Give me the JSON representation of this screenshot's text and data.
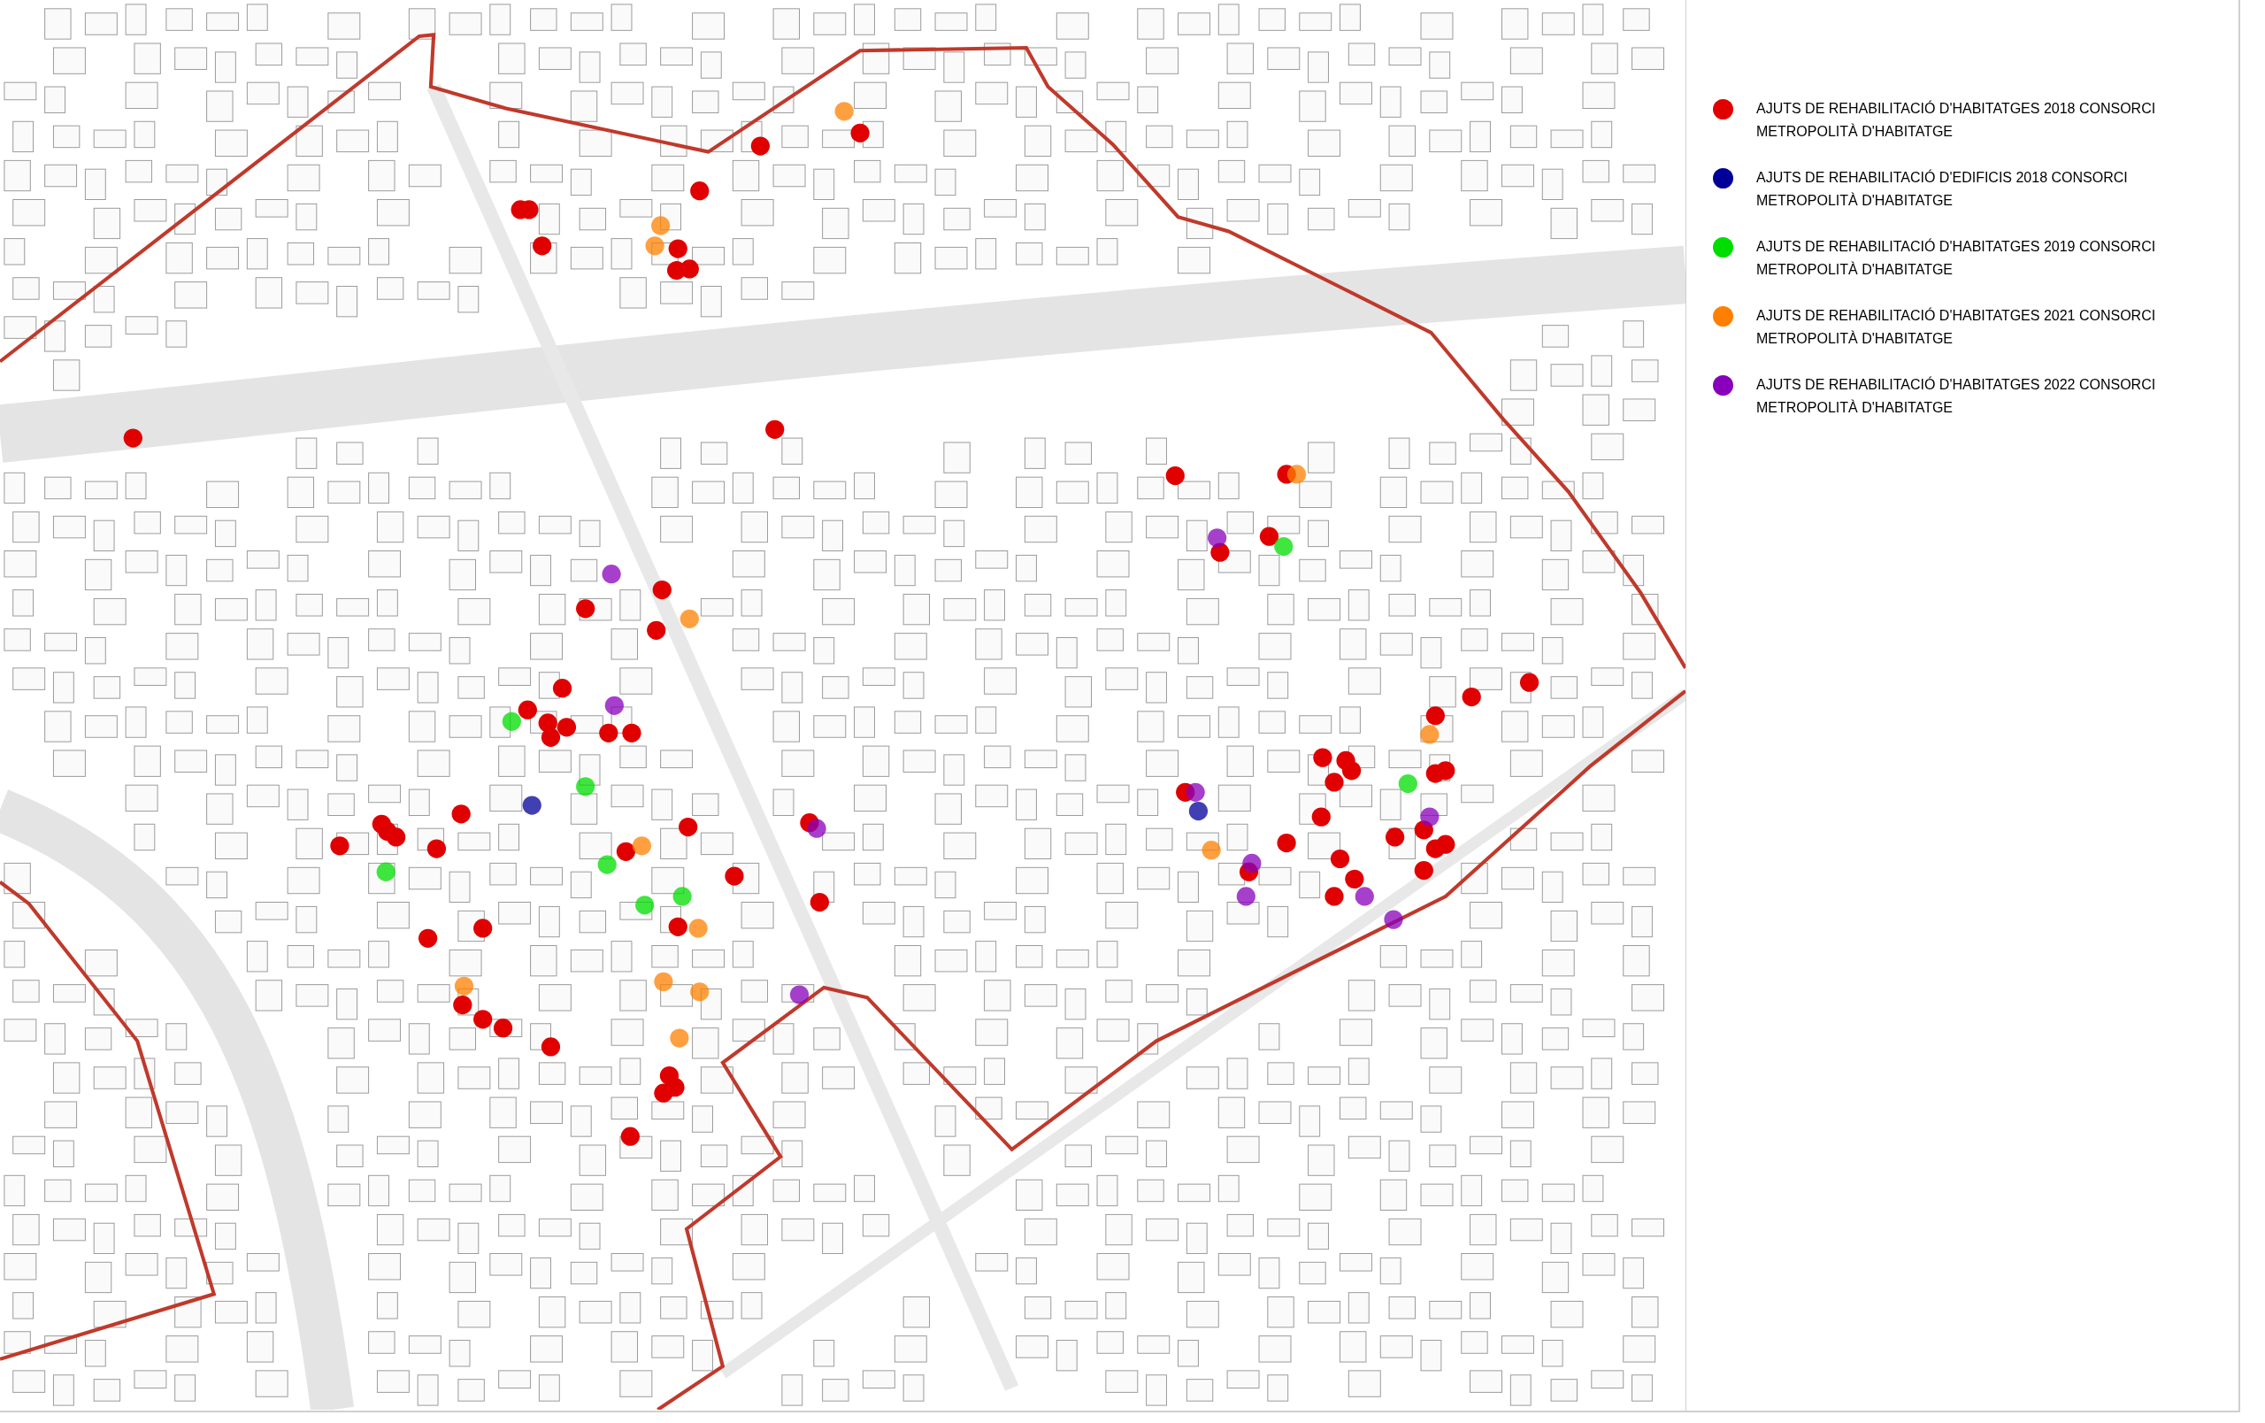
{
  "legend": [
    {
      "label": "AJUTS DE REHABILITACIÓ D'HABITATGES 2018 CONSORCI METROPOLITÀ D'HABITATGE",
      "color": "#e00000"
    },
    {
      "label": "AJUTS DE REHABILITACIÓ D'EDIFICIS 2018 CONSORCI METROPOLITÀ D'HABITATGE",
      "color": "#000099"
    },
    {
      "label": "AJUTS DE REHABILITACIÓ D'HABITATGES 2019 CONSORCI METROPOLITÀ D'HABITATGE",
      "color": "#00dd00"
    },
    {
      "label": "AJUTS DE REHABILITACIÓ D'HABITATGES 2021 CONSORCI METROPOLITÀ D'HABITATGE",
      "color": "#ff8000"
    },
    {
      "label": "AJUTS DE REHABILITACIÓ D'HABITATGES 2022 CONSORCI METROPOLITÀ D'HABITATGE",
      "color": "#8800bb"
    }
  ]
}
